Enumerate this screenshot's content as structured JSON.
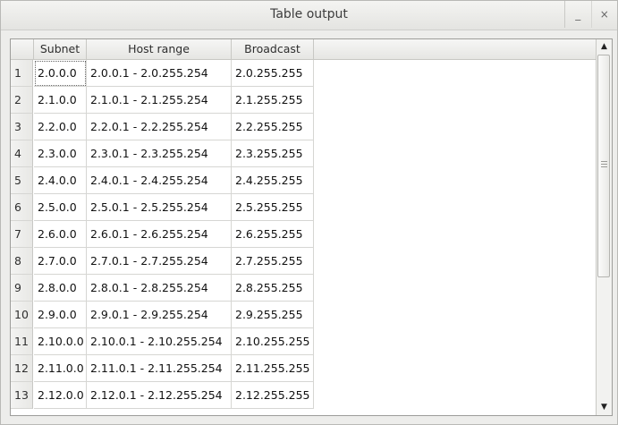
{
  "window": {
    "title": "Table output",
    "minimize_glyph": "_",
    "close_glyph": "×"
  },
  "table": {
    "columns": [
      "Subnet",
      "Host range",
      "Broadcast"
    ],
    "rows": [
      {
        "num": "1",
        "subnet": "2.0.0.0",
        "range": "2.0.0.1  -  2.0.255.254",
        "broadcast": "2.0.255.255"
      },
      {
        "num": "2",
        "subnet": "2.1.0.0",
        "range": "2.1.0.1  -  2.1.255.254",
        "broadcast": "2.1.255.255"
      },
      {
        "num": "3",
        "subnet": "2.2.0.0",
        "range": "2.2.0.1  -  2.2.255.254",
        "broadcast": "2.2.255.255"
      },
      {
        "num": "4",
        "subnet": "2.3.0.0",
        "range": "2.3.0.1  -  2.3.255.254",
        "broadcast": "2.3.255.255"
      },
      {
        "num": "5",
        "subnet": "2.4.0.0",
        "range": "2.4.0.1  -  2.4.255.254",
        "broadcast": "2.4.255.255"
      },
      {
        "num": "6",
        "subnet": "2.5.0.0",
        "range": "2.5.0.1  -  2.5.255.254",
        "broadcast": "2.5.255.255"
      },
      {
        "num": "7",
        "subnet": "2.6.0.0",
        "range": "2.6.0.1  -  2.6.255.254",
        "broadcast": "2.6.255.255"
      },
      {
        "num": "8",
        "subnet": "2.7.0.0",
        "range": "2.7.0.1  -  2.7.255.254",
        "broadcast": "2.7.255.255"
      },
      {
        "num": "9",
        "subnet": "2.8.0.0",
        "range": "2.8.0.1  -  2.8.255.254",
        "broadcast": "2.8.255.255"
      },
      {
        "num": "10",
        "subnet": "2.9.0.0",
        "range": "2.9.0.1  -  2.9.255.254",
        "broadcast": "2.9.255.255"
      },
      {
        "num": "11",
        "subnet": "2.10.0.0",
        "range": "2.10.0.1  -  2.10.255.254",
        "broadcast": "2.10.255.255"
      },
      {
        "num": "12",
        "subnet": "2.11.0.0",
        "range": "2.11.0.1  -  2.11.255.254",
        "broadcast": "2.11.255.255"
      },
      {
        "num": "13",
        "subnet": "2.12.0.0",
        "range": "2.12.0.1  -  2.12.255.254",
        "broadcast": "2.12.255.255"
      }
    ]
  },
  "scrollbar": {
    "up_glyph": "▲",
    "down_glyph": "▼"
  }
}
